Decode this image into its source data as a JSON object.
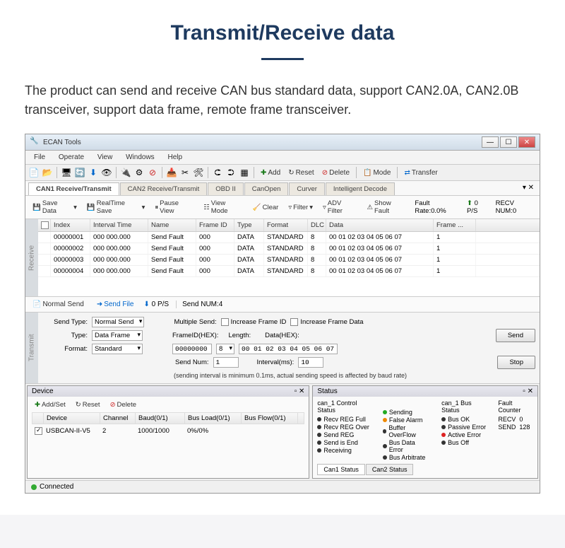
{
  "page": {
    "title": "Transmit/Receive data",
    "description": "The product can send and receive CAN bus standard data, support CAN2.0A, CAN2.0B transceiver, support data frame, remote frame transceiver."
  },
  "window": {
    "title": "ECAN Tools"
  },
  "menu": [
    "File",
    "Operate",
    "View",
    "Windows",
    "Help"
  ],
  "toolbar2": {
    "add": "Add",
    "reset": "Reset",
    "delete": "Delete",
    "mode": "Mode",
    "transfer": "Transfer"
  },
  "tabs": [
    "CAN1 Receive/Transmit",
    "CAN2 Receive/Transmit",
    "OBD II",
    "CanOpen",
    "Curver",
    "Intelligent Decode"
  ],
  "subbar": {
    "save": "Save Data",
    "realtime": "RealTime Save",
    "pause": "Pause View",
    "viewmode": "View Mode",
    "clear": "Clear",
    "filter": "Filter",
    "advfilter": "ADV Filter",
    "showfault": "Show Fault",
    "faultrate": "Fault Rate:0.0%",
    "ps": "0 P/S",
    "recv": "RECV NUM:0"
  },
  "sideLabels": {
    "receive": "Receive",
    "transmit": "Transmit"
  },
  "grid": {
    "headers": [
      "",
      "Index",
      "Interval Time",
      "Name",
      "Frame ID",
      "Type",
      "Format",
      "DLC",
      "Data",
      "Frame ..."
    ],
    "rows": [
      {
        "idx": "00000001",
        "int": "000 000.000",
        "name": "Send Fault",
        "fid": "000",
        "type": "DATA",
        "fmt": "STANDARD",
        "dlc": "8",
        "data": "00 01 02 03 04 05 06 07",
        "frame": "1"
      },
      {
        "idx": "00000002",
        "int": "000 000.000",
        "name": "Send Fault",
        "fid": "000",
        "type": "DATA",
        "fmt": "STANDARD",
        "dlc": "8",
        "data": "00 01 02 03 04 05 06 07",
        "frame": "1"
      },
      {
        "idx": "00000003",
        "int": "000 000.000",
        "name": "Send Fault",
        "fid": "000",
        "type": "DATA",
        "fmt": "STANDARD",
        "dlc": "8",
        "data": "00 01 02 03 04 05 06 07",
        "frame": "1"
      },
      {
        "idx": "00000004",
        "int": "000 000.000",
        "name": "Send Fault",
        "fid": "000",
        "type": "DATA",
        "fmt": "STANDARD",
        "dlc": "8",
        "data": "00 01 02 03 04 05 06 07",
        "frame": "1"
      }
    ]
  },
  "sendbar": {
    "normal": "Normal Send",
    "sendfile": "Send File",
    "ps": "0 P/S",
    "sendnum": "Send NUM:4"
  },
  "form": {
    "sendTypeLabel": "Send Type:",
    "sendType": "Normal Send",
    "multipleSend": "Multiple Send:",
    "increaseId": "Increase Frame ID",
    "increaseData": "Increase Frame Data",
    "typeLabel": "Type:",
    "type": "Data Frame",
    "frameIdLabel": "FrameID(HEX):",
    "frameId": "00000000",
    "lengthLabel": "Length:",
    "length": "8",
    "dataLabel": "Data(HEX):",
    "data": "00 01 02 03 04 05 06 07",
    "formatLabel": "Format:",
    "format": "Standard",
    "sendNumLabel": "Send Num:",
    "sendNum": "1",
    "intervalLabel": "Interval(ms):",
    "interval": "10",
    "sendBtn": "Send",
    "stopBtn": "Stop",
    "note": "(sending interval is minimum 0.1ms, actual sending speed is affected by baud rate)"
  },
  "device": {
    "title": "Device",
    "addset": "Add/Set",
    "reset": "Reset",
    "delete": "Delete",
    "headers": [
      "",
      "Device",
      "Channel",
      "Baud(0/1)",
      "Bus Load(0/1)",
      "Bus Flow(0/1)"
    ],
    "row": {
      "chk": "✓",
      "device": "USBCAN-II-V5",
      "channel": "2",
      "baud": "1000/1000",
      "load": "0%/0%",
      "flow": ""
    }
  },
  "status": {
    "title": "Status",
    "ctrlHead": "can_1 Control Status",
    "busHead": "can_1 Bus Status",
    "faultHead": "Fault Counter",
    "ctrl": [
      "Recv REG Full",
      "Recv REG Over",
      "Send REG",
      "Send is End",
      "Receiving"
    ],
    "mid": [
      "Sending",
      "False Alarm",
      "Buffer OverFlow",
      "Bus Data Error",
      "Bus Arbitrate"
    ],
    "bus": [
      "Bus OK",
      "Passive Error",
      "Active Error",
      "Bus Off"
    ],
    "fault": {
      "recv": "RECV",
      "recvN": "0",
      "send": "SEND",
      "sendN": "128"
    },
    "tabs": [
      "Can1 Status",
      "Can2 Status"
    ]
  },
  "footer": {
    "connected": "Connected"
  }
}
